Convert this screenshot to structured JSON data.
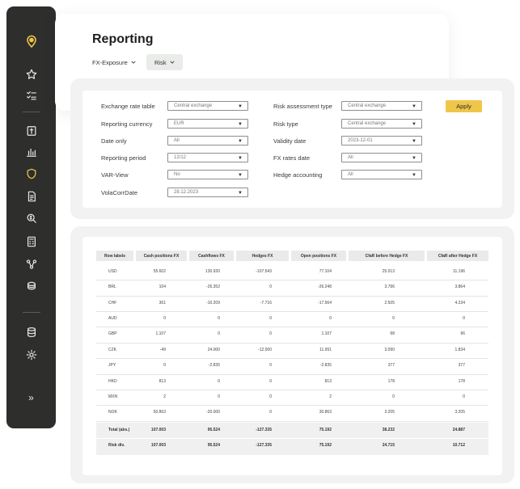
{
  "sidebar": {
    "icons": [
      "location-pin-icon",
      "star-icon",
      "checklist-icon",
      "book-icon",
      "bar-chart-icon",
      "shield-icon",
      "document-icon",
      "search-money-icon",
      "calculator-icon",
      "flow-icon",
      "coins-icon",
      "database-icon",
      "settings-icon",
      "expand-icon"
    ],
    "expand": "»",
    "accent": "#f0c64a"
  },
  "header": {
    "title": "Reporting",
    "tabs": [
      {
        "label": "FX-Exposure"
      },
      {
        "label": "Risk"
      }
    ]
  },
  "filters": {
    "left": [
      {
        "label": "Exchange rate table",
        "value": "Central exchange"
      },
      {
        "label": "Reporting currency",
        "value": "EUR"
      },
      {
        "label": "Date only",
        "value": "All"
      },
      {
        "label": "Reporting period",
        "value": "12/12"
      },
      {
        "label": "VAR-View",
        "value": "No"
      },
      {
        "label": "VolaCorrDate",
        "value": "28.12.2023"
      }
    ],
    "right": [
      {
        "label": "Risk assessment type",
        "value": "Central exchange"
      },
      {
        "label": "Risk type",
        "value": "Central exchange"
      },
      {
        "label": "Validity date",
        "value": "2023-12-01"
      },
      {
        "label": "FX rates date",
        "value": "All"
      },
      {
        "label": "Hedge accounting",
        "value": "All"
      }
    ],
    "apply_label": "Apply"
  },
  "table": {
    "headers": [
      "Row labels",
      "Cash positions FX",
      "Cashflows FX",
      "Hedges FX",
      "Open positions FX",
      "CfaR before Hedge FX",
      "CfaR after Hedge FX"
    ],
    "rows": [
      {
        "label": "USD",
        "values": [
          "55.602",
          "130.920",
          "-107.543",
          "77.104",
          "25.013",
          "11.196"
        ]
      },
      {
        "label": "BRL",
        "values": [
          "104",
          "-26.352",
          "0",
          "-26.248",
          "3.796",
          "3.864"
        ]
      },
      {
        "label": "CHF",
        "values": [
          "361",
          "-10.209",
          "-7.716",
          "-17.564",
          "2.505",
          "4.234"
        ]
      },
      {
        "label": "AUD",
        "values": [
          "0",
          "0",
          "0",
          "0",
          "0",
          "0"
        ]
      },
      {
        "label": "GBP",
        "values": [
          "1.107",
          "0",
          "0",
          "1.107",
          "68",
          "66"
        ]
      },
      {
        "label": "CZK",
        "values": [
          "-49",
          "24.000",
          "-12.000",
          "11.951",
          "3.090",
          "1.834"
        ]
      },
      {
        "label": "JPY",
        "values": [
          "0",
          "-2.835",
          "0",
          "-2.835",
          "377",
          "377"
        ]
      },
      {
        "label": "HKD",
        "values": [
          "813",
          "0",
          "0",
          "813",
          "178",
          "178"
        ]
      },
      {
        "label": "MXN",
        "values": [
          "2",
          "0",
          "0",
          "2",
          "0",
          "0"
        ]
      },
      {
        "label": "NOK",
        "values": [
          "50.863",
          "-20.000",
          "0",
          "30.863",
          "3.205",
          "3.205"
        ]
      }
    ],
    "totals": [
      {
        "label": "Total (abs.)",
        "values": [
          "107.003",
          "95.524",
          "-127.335",
          "75.192",
          "38.232",
          "24.887"
        ]
      },
      {
        "label": "Risk div.",
        "values": [
          "107.003",
          "95.524",
          "-127.335",
          "75.192",
          "24.715",
          "10.712"
        ]
      }
    ]
  }
}
